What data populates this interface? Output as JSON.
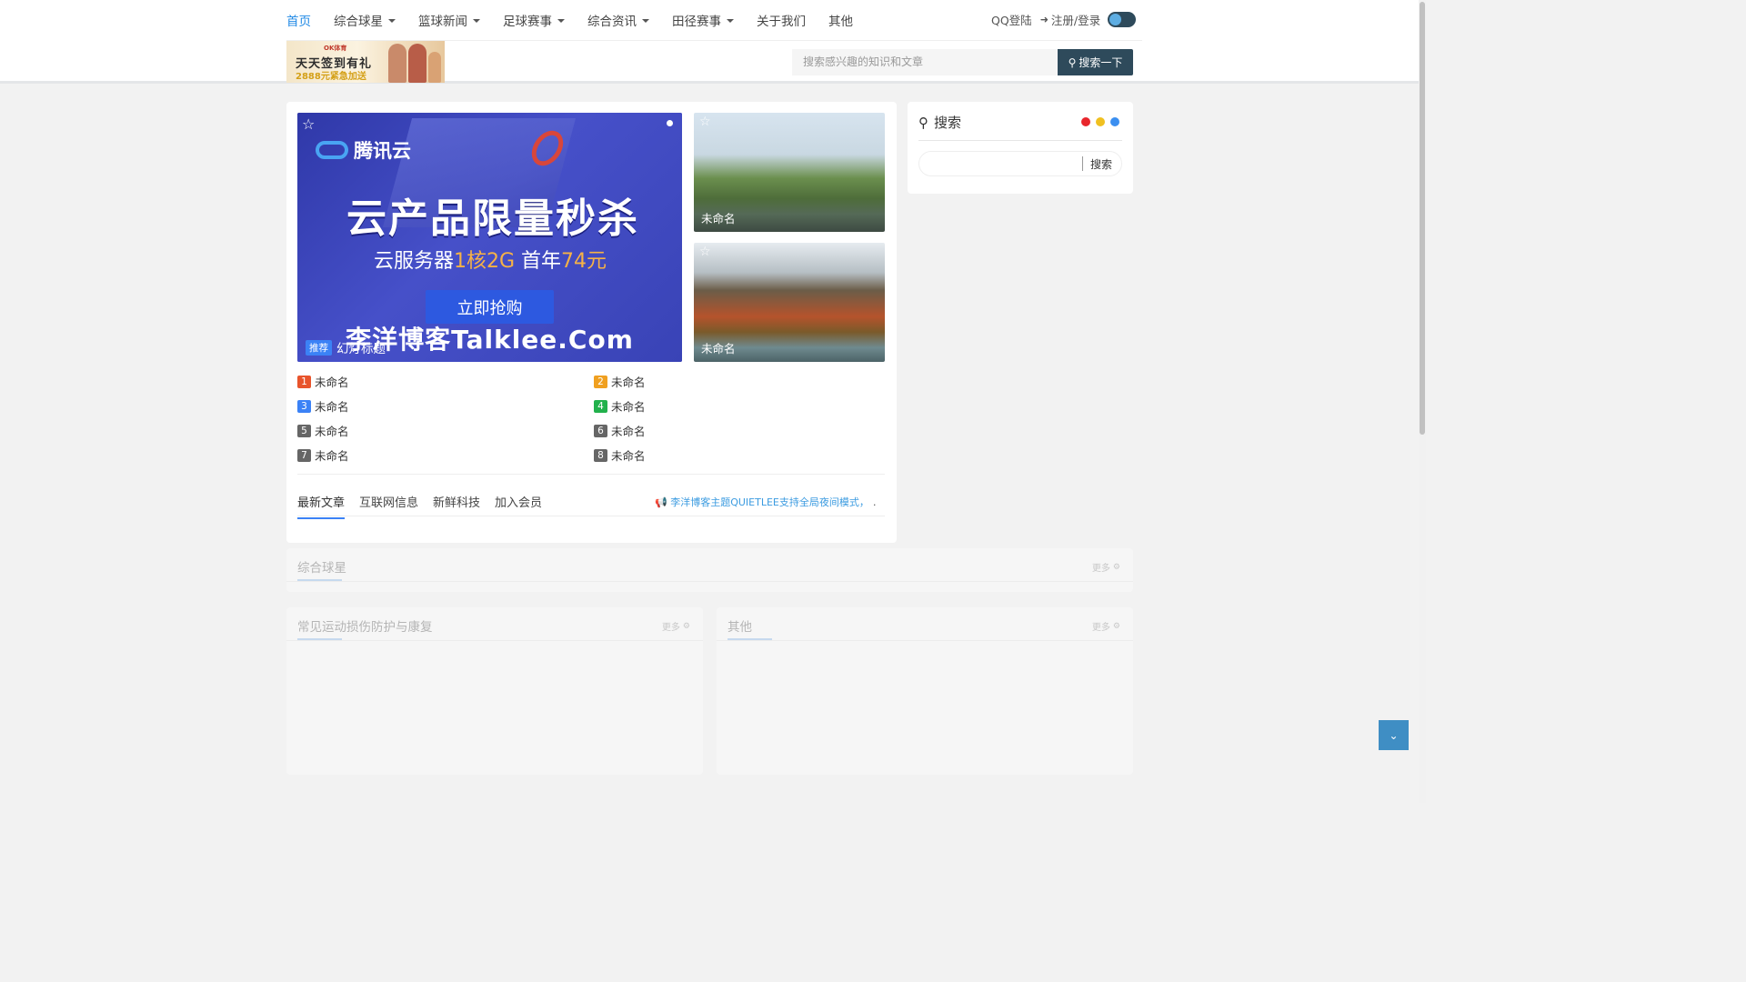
{
  "nav": {
    "items": [
      {
        "label": "首页",
        "active": true,
        "dropdown": false
      },
      {
        "label": "综合球星",
        "active": false,
        "dropdown": true
      },
      {
        "label": "篮球新闻",
        "active": false,
        "dropdown": true
      },
      {
        "label": "足球赛事",
        "active": false,
        "dropdown": true
      },
      {
        "label": "综合资讯",
        "active": false,
        "dropdown": true
      },
      {
        "label": "田径赛事",
        "active": false,
        "dropdown": true
      },
      {
        "label": "关于我们",
        "active": false,
        "dropdown": false
      },
      {
        "label": "其他",
        "active": false,
        "dropdown": false
      }
    ],
    "qq_login": "QQ登陆",
    "register_login": "注册/登录",
    "login_icon": "sign-in-icon",
    "theme_toggle": {
      "icon": "dark-mode-toggle",
      "on": true
    }
  },
  "banner": {
    "small_text": "OK体育",
    "main_text": "天天签到有礼",
    "sub_text": "2888元紧急加送"
  },
  "header_search": {
    "placeholder": "搜索感兴趣的知识和文章",
    "button_label": "搜索一下",
    "icon": "search-icon"
  },
  "slider": {
    "logo_text": "腾讯云",
    "headline": "云产品限量秒杀",
    "subline_prefix": "云服务器",
    "subline_highlight_1": "1核2G",
    "subline_mid": "首年",
    "subline_highlight_2": "74元",
    "buy_label": "立即抢购",
    "site_text": "李洋博客Talklee.Com",
    "badge": "推荐",
    "caption": "幻灯标题",
    "star_icon": "star-icon"
  },
  "side_images": [
    {
      "caption": "未命名"
    },
    {
      "caption": "未命名"
    }
  ],
  "ranked_list": [
    {
      "num": "1",
      "title": "未命名",
      "color": "#e8542c"
    },
    {
      "num": "2",
      "title": "未命名",
      "color": "#f0a020"
    },
    {
      "num": "3",
      "title": "未命名",
      "color": "#3b82f6"
    },
    {
      "num": "4",
      "title": "未命名",
      "color": "#22b14c"
    },
    {
      "num": "5",
      "title": "未命名",
      "color": "#666666"
    },
    {
      "num": "6",
      "title": "未命名",
      "color": "#666666"
    },
    {
      "num": "7",
      "title": "未命名",
      "color": "#666666"
    },
    {
      "num": "8",
      "title": "未命名",
      "color": "#666666"
    }
  ],
  "tabs": [
    {
      "label": "最新文章",
      "active": true
    },
    {
      "label": "互联网信息",
      "active": false
    },
    {
      "label": "新鲜科技",
      "active": false
    },
    {
      "label": "加入会员",
      "active": false
    }
  ],
  "notice": {
    "icon": "megaphone-icon",
    "text": "李洋博客主题QUIETLEE支持全局夜间模式，",
    "ellipsis": "…"
  },
  "search_widget": {
    "title": "搜索",
    "button_label": "搜索",
    "dot_colors": [
      "#e8262c",
      "#f0c020",
      "#3b8ff0"
    ]
  },
  "sections": [
    {
      "title": "综合球星",
      "more": "更多"
    },
    {
      "title": "常见运动损伤防护与康复",
      "more": "更多"
    },
    {
      "title": "其他",
      "more": "更多"
    }
  ],
  "scroll_button": {
    "icon": "chevron-down-icon"
  },
  "colors": {
    "accent": "#1e88e5",
    "dark_button": "#2e4a5b",
    "scroll_button": "#3f8ec4"
  }
}
